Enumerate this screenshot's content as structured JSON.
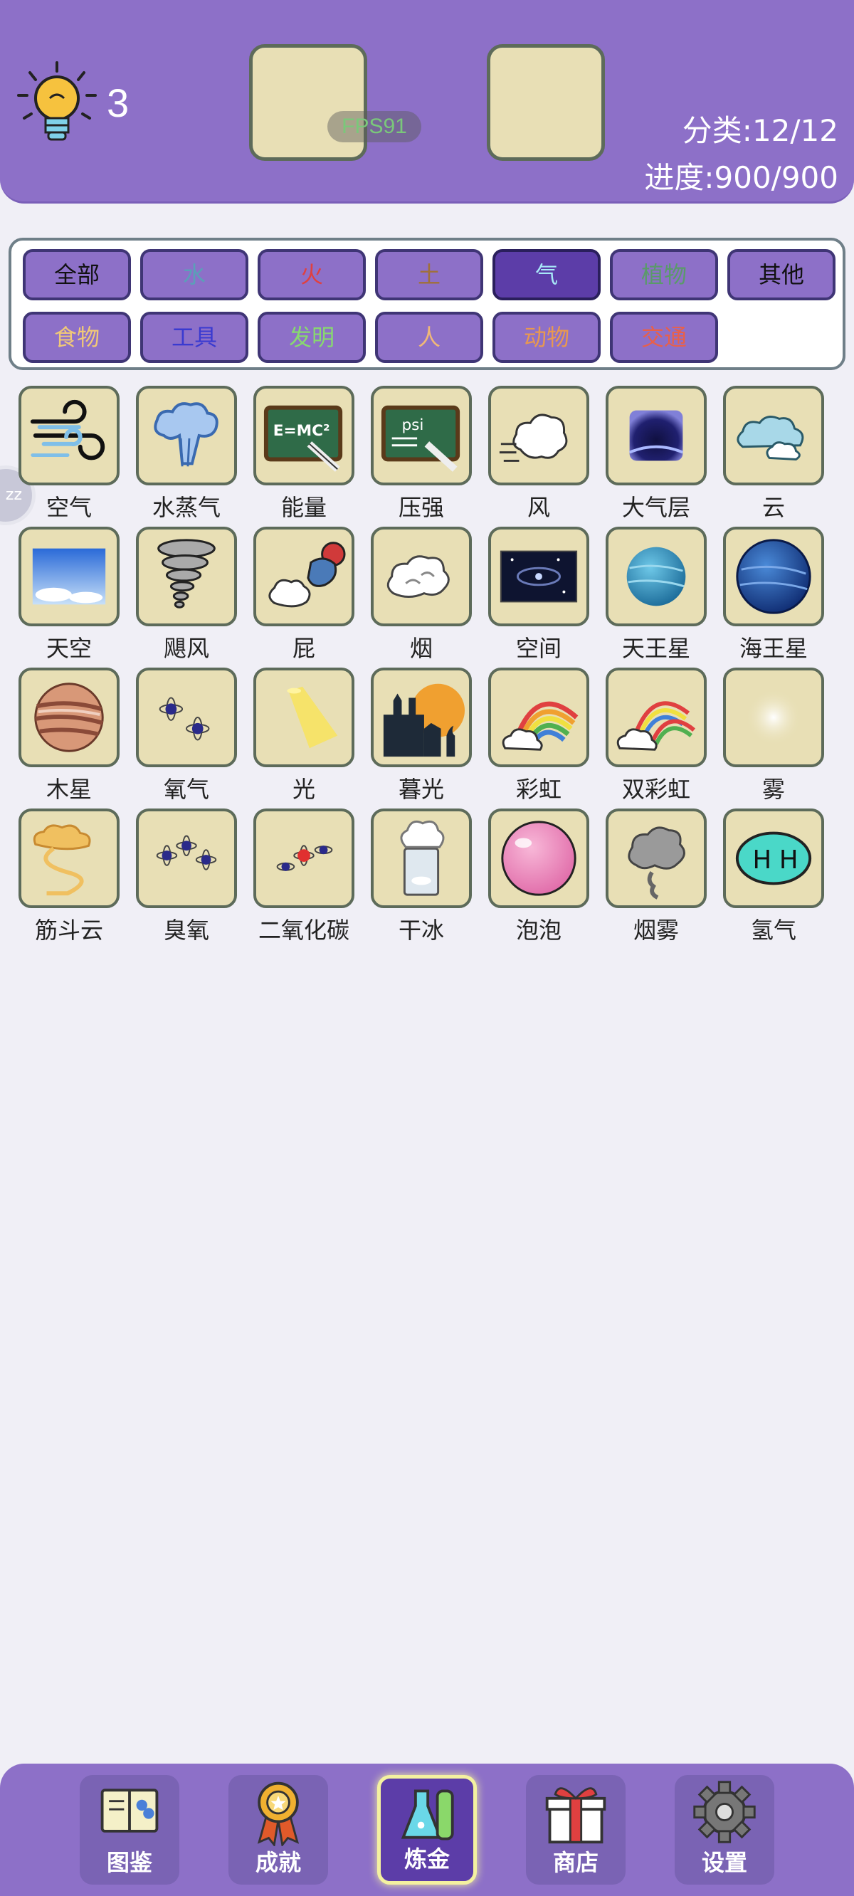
{
  "header": {
    "hint_icon": "lightbulb-icon",
    "hint_count": "3",
    "fps": "FPS91",
    "category_count": "分类:12/12",
    "progress": "进度:900/900"
  },
  "filters": [
    {
      "label": "全部",
      "color": "#111111"
    },
    {
      "label": "水",
      "color": "#5aa0b8"
    },
    {
      "label": "火",
      "color": "#e04040"
    },
    {
      "label": "土",
      "color": "#a0703a"
    },
    {
      "label": "气",
      "color": "#a8e8f8",
      "active": true
    },
    {
      "label": "植物",
      "color": "#5a9a6a"
    },
    {
      "label": "其他",
      "color": "#111111"
    },
    {
      "label": "食物",
      "color": "#f0c878"
    },
    {
      "label": "工具",
      "color": "#3a3ad0"
    },
    {
      "label": "发明",
      "color": "#88d870"
    },
    {
      "label": "人",
      "color": "#f0b878"
    },
    {
      "label": "动物",
      "color": "#e89850"
    },
    {
      "label": "交通",
      "color": "#e8604a"
    }
  ],
  "elements": [
    {
      "label": "空气",
      "icon": "wind-swirl-icon"
    },
    {
      "label": "水蒸气",
      "icon": "steam-cloud-icon"
    },
    {
      "label": "能量",
      "icon": "emc2-chalkboard-icon"
    },
    {
      "label": "压强",
      "icon": "psi-chalkboard-icon"
    },
    {
      "label": "风",
      "icon": "wind-puff-icon"
    },
    {
      "label": "大气层",
      "icon": "atmosphere-icon"
    },
    {
      "label": "云",
      "icon": "cloud-icon"
    },
    {
      "label": "天空",
      "icon": "sky-icon"
    },
    {
      "label": "飓风",
      "icon": "tornado-icon"
    },
    {
      "label": "屁",
      "icon": "fart-icon"
    },
    {
      "label": "烟",
      "icon": "smoke-icon"
    },
    {
      "label": "空间",
      "icon": "galaxy-icon"
    },
    {
      "label": "天王星",
      "icon": "uranus-icon"
    },
    {
      "label": "海王星",
      "icon": "neptune-icon"
    },
    {
      "label": "木星",
      "icon": "jupiter-icon"
    },
    {
      "label": "氧气",
      "icon": "oxygen-atoms-icon"
    },
    {
      "label": "光",
      "icon": "light-beam-icon"
    },
    {
      "label": "暮光",
      "icon": "twilight-icon"
    },
    {
      "label": "彩虹",
      "icon": "rainbow-icon"
    },
    {
      "label": "双彩虹",
      "icon": "double-rainbow-icon"
    },
    {
      "label": "雾",
      "icon": "fog-icon"
    },
    {
      "label": "筋斗云",
      "icon": "somersault-cloud-icon"
    },
    {
      "label": "臭氧",
      "icon": "ozone-atoms-icon"
    },
    {
      "label": "二氧化碳",
      "icon": "co2-atoms-icon"
    },
    {
      "label": "干冰",
      "icon": "dry-ice-icon"
    },
    {
      "label": "泡泡",
      "icon": "bubble-icon"
    },
    {
      "label": "烟雾",
      "icon": "smog-icon"
    },
    {
      "label": "氢气",
      "icon": "hydrogen-icon"
    }
  ],
  "nav": [
    {
      "label": "图鉴",
      "icon": "book-icon"
    },
    {
      "label": "成就",
      "icon": "medal-icon"
    },
    {
      "label": "炼金",
      "icon": "flask-icon",
      "active": true
    },
    {
      "label": "商店",
      "icon": "gift-icon"
    },
    {
      "label": "设置",
      "icon": "gear-icon"
    }
  ],
  "side_bubble": "zz"
}
